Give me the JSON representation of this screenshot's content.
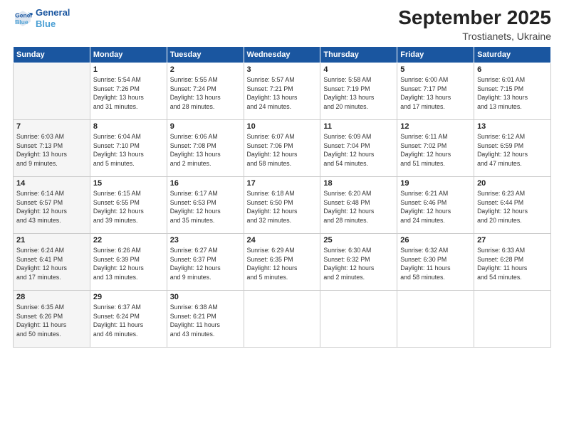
{
  "logo": {
    "line1": "General",
    "line2": "Blue"
  },
  "title": "September 2025",
  "location": "Trostianets, Ukraine",
  "days_of_week": [
    "Sunday",
    "Monday",
    "Tuesday",
    "Wednesday",
    "Thursday",
    "Friday",
    "Saturday"
  ],
  "weeks": [
    [
      {
        "day": "",
        "info": ""
      },
      {
        "day": "1",
        "info": "Sunrise: 5:54 AM\nSunset: 7:26 PM\nDaylight: 13 hours\nand 31 minutes."
      },
      {
        "day": "2",
        "info": "Sunrise: 5:55 AM\nSunset: 7:24 PM\nDaylight: 13 hours\nand 28 minutes."
      },
      {
        "day": "3",
        "info": "Sunrise: 5:57 AM\nSunset: 7:21 PM\nDaylight: 13 hours\nand 24 minutes."
      },
      {
        "day": "4",
        "info": "Sunrise: 5:58 AM\nSunset: 7:19 PM\nDaylight: 13 hours\nand 20 minutes."
      },
      {
        "day": "5",
        "info": "Sunrise: 6:00 AM\nSunset: 7:17 PM\nDaylight: 13 hours\nand 17 minutes."
      },
      {
        "day": "6",
        "info": "Sunrise: 6:01 AM\nSunset: 7:15 PM\nDaylight: 13 hours\nand 13 minutes."
      }
    ],
    [
      {
        "day": "7",
        "info": "Sunrise: 6:03 AM\nSunset: 7:13 PM\nDaylight: 13 hours\nand 9 minutes."
      },
      {
        "day": "8",
        "info": "Sunrise: 6:04 AM\nSunset: 7:10 PM\nDaylight: 13 hours\nand 5 minutes."
      },
      {
        "day": "9",
        "info": "Sunrise: 6:06 AM\nSunset: 7:08 PM\nDaylight: 13 hours\nand 2 minutes."
      },
      {
        "day": "10",
        "info": "Sunrise: 6:07 AM\nSunset: 7:06 PM\nDaylight: 12 hours\nand 58 minutes."
      },
      {
        "day": "11",
        "info": "Sunrise: 6:09 AM\nSunset: 7:04 PM\nDaylight: 12 hours\nand 54 minutes."
      },
      {
        "day": "12",
        "info": "Sunrise: 6:11 AM\nSunset: 7:02 PM\nDaylight: 12 hours\nand 51 minutes."
      },
      {
        "day": "13",
        "info": "Sunrise: 6:12 AM\nSunset: 6:59 PM\nDaylight: 12 hours\nand 47 minutes."
      }
    ],
    [
      {
        "day": "14",
        "info": "Sunrise: 6:14 AM\nSunset: 6:57 PM\nDaylight: 12 hours\nand 43 minutes."
      },
      {
        "day": "15",
        "info": "Sunrise: 6:15 AM\nSunset: 6:55 PM\nDaylight: 12 hours\nand 39 minutes."
      },
      {
        "day": "16",
        "info": "Sunrise: 6:17 AM\nSunset: 6:53 PM\nDaylight: 12 hours\nand 35 minutes."
      },
      {
        "day": "17",
        "info": "Sunrise: 6:18 AM\nSunset: 6:50 PM\nDaylight: 12 hours\nand 32 minutes."
      },
      {
        "day": "18",
        "info": "Sunrise: 6:20 AM\nSunset: 6:48 PM\nDaylight: 12 hours\nand 28 minutes."
      },
      {
        "day": "19",
        "info": "Sunrise: 6:21 AM\nSunset: 6:46 PM\nDaylight: 12 hours\nand 24 minutes."
      },
      {
        "day": "20",
        "info": "Sunrise: 6:23 AM\nSunset: 6:44 PM\nDaylight: 12 hours\nand 20 minutes."
      }
    ],
    [
      {
        "day": "21",
        "info": "Sunrise: 6:24 AM\nSunset: 6:41 PM\nDaylight: 12 hours\nand 17 minutes."
      },
      {
        "day": "22",
        "info": "Sunrise: 6:26 AM\nSunset: 6:39 PM\nDaylight: 12 hours\nand 13 minutes."
      },
      {
        "day": "23",
        "info": "Sunrise: 6:27 AM\nSunset: 6:37 PM\nDaylight: 12 hours\nand 9 minutes."
      },
      {
        "day": "24",
        "info": "Sunrise: 6:29 AM\nSunset: 6:35 PM\nDaylight: 12 hours\nand 5 minutes."
      },
      {
        "day": "25",
        "info": "Sunrise: 6:30 AM\nSunset: 6:32 PM\nDaylight: 12 hours\nand 2 minutes."
      },
      {
        "day": "26",
        "info": "Sunrise: 6:32 AM\nSunset: 6:30 PM\nDaylight: 11 hours\nand 58 minutes."
      },
      {
        "day": "27",
        "info": "Sunrise: 6:33 AM\nSunset: 6:28 PM\nDaylight: 11 hours\nand 54 minutes."
      }
    ],
    [
      {
        "day": "28",
        "info": "Sunrise: 6:35 AM\nSunset: 6:26 PM\nDaylight: 11 hours\nand 50 minutes."
      },
      {
        "day": "29",
        "info": "Sunrise: 6:37 AM\nSunset: 6:24 PM\nDaylight: 11 hours\nand 46 minutes."
      },
      {
        "day": "30",
        "info": "Sunrise: 6:38 AM\nSunset: 6:21 PM\nDaylight: 11 hours\nand 43 minutes."
      },
      {
        "day": "",
        "info": ""
      },
      {
        "day": "",
        "info": ""
      },
      {
        "day": "",
        "info": ""
      },
      {
        "day": "",
        "info": ""
      }
    ]
  ]
}
